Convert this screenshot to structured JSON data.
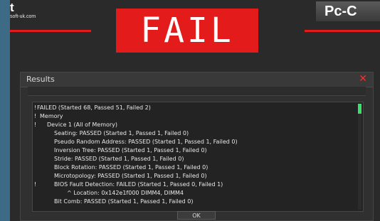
{
  "header": {
    "logo_left_big": "t",
    "logo_left_small": "soft-uk.com",
    "logo_right": "Pc-C",
    "banner_text": "FAIL"
  },
  "dialog": {
    "title": "Results",
    "close_icon": "close-icon",
    "ok_label": "OK"
  },
  "results": {
    "lines": [
      {
        "prefix": "!",
        "text": "FAILED (Started 68, Passed 51, Failed 2)"
      },
      {
        "prefix": "!",
        "text": "Memory"
      },
      {
        "prefix": "!",
        "text": "Device 1 (All of Memory)"
      },
      {
        "prefix": "",
        "text": "Seating: PASSED (Started 1, Passed 1, Failed 0)"
      },
      {
        "prefix": "",
        "text": "Pseudo Random Address: PASSED (Started 1, Passed 1, Failed 0)"
      },
      {
        "prefix": "",
        "text": "Inversion Tree: PASSED (Started 1, Passed 1, Failed 0)"
      },
      {
        "prefix": "",
        "text": "Stride: PASSED (Started 1, Passed 1, Failed 0)"
      },
      {
        "prefix": "",
        "text": "Block Rotation: PASSED (Started 1, Passed 1, Failed 0)"
      },
      {
        "prefix": "",
        "text": "Microtopology: PASSED (Started 1, Passed 1, Failed 0)"
      },
      {
        "prefix": "!",
        "text": "BIOS Fault Detection: FAILED (Started 1, Passed 0, Failed 1)"
      },
      {
        "prefix": "",
        "text": "^ Location: 0x142e1f000 DIMM4, DIMM4"
      },
      {
        "prefix": "",
        "text": "Bit Comb: PASSED (Started 1, Passed 1, Failed 0)"
      }
    ]
  },
  "colors": {
    "accent_red": "#e31b1b",
    "scroll_thumb": "#3be06b",
    "background": "#2a2a2a"
  }
}
